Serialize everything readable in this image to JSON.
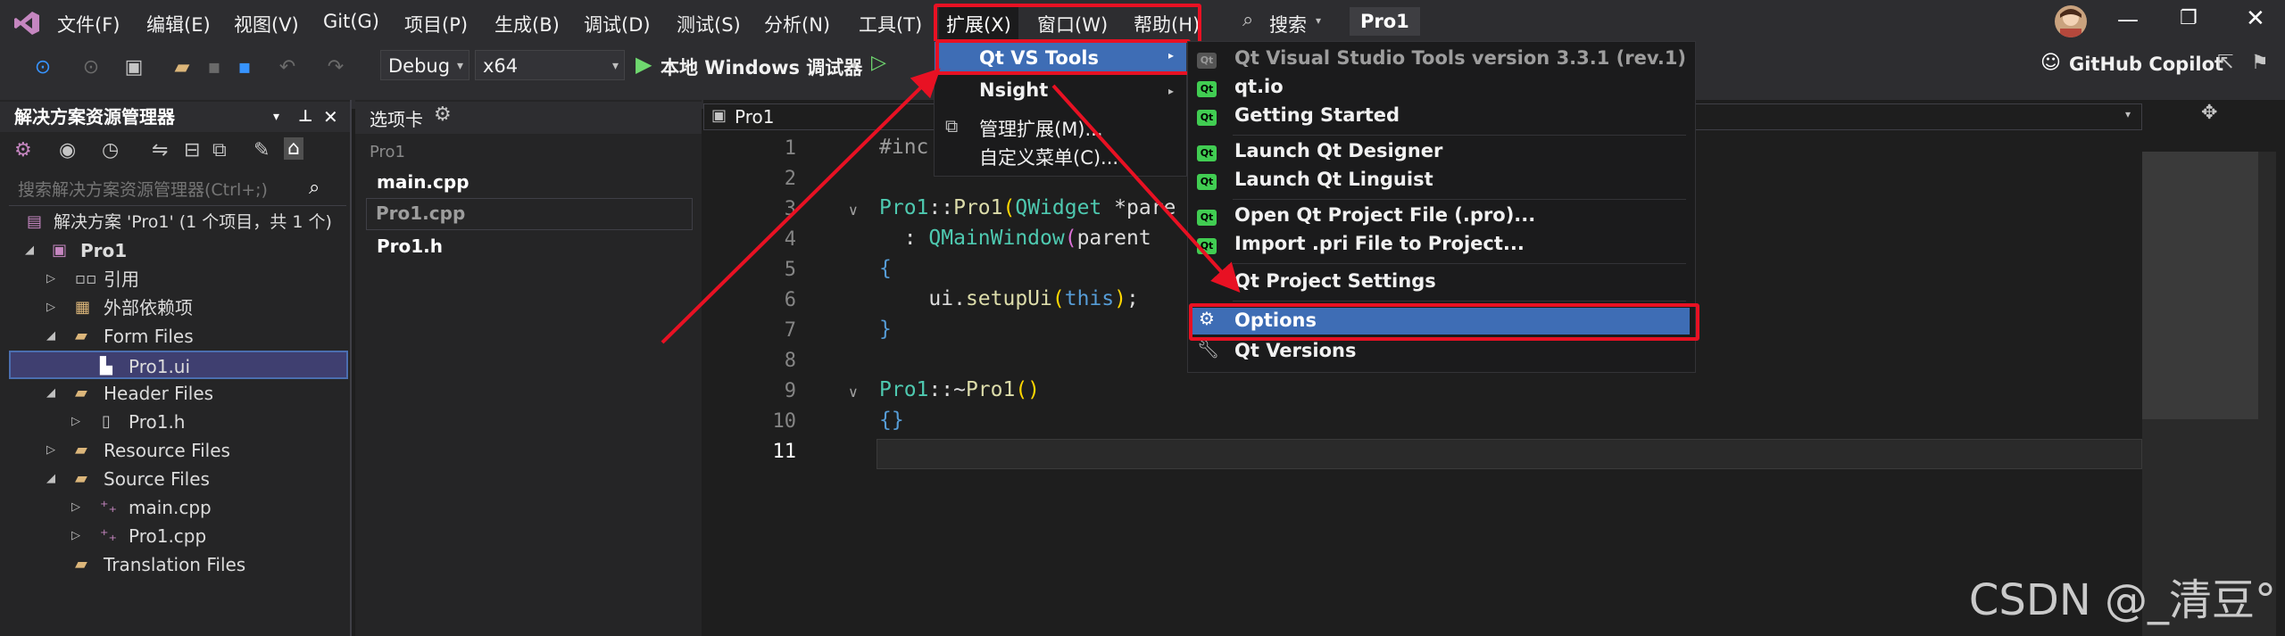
{
  "menubar": {
    "items": [
      "文件(F)",
      "编辑(E)",
      "视图(V)",
      "Git(G)",
      "项目(P)",
      "生成(B)",
      "调试(D)",
      "测试(S)",
      "分析(N)",
      "工具(T)",
      "扩展(X)",
      "窗口(W)",
      "帮助(H)"
    ],
    "search_label": "搜索",
    "project_badge": "Pro1",
    "window_controls": [
      "minimize-icon",
      "restore-icon",
      "close-icon"
    ]
  },
  "toolbar": {
    "config": "Debug",
    "platform": "x64",
    "run_label": "本地 Windows 调试器",
    "copilot_label": "GitHub Copilot"
  },
  "solution_explorer": {
    "title": "解决方案资源管理器",
    "search_placeholder": "搜索解决方案资源管理器(Ctrl+;)",
    "solution_label": "解决方案 'Pro1' (1 个项目，共 1 个)",
    "project": "Pro1",
    "nodes": [
      "引用",
      "外部依赖项",
      "Form Files",
      "Pro1.ui",
      "Header Files",
      "Pro1.h",
      "Resource Files",
      "Source Files",
      "main.cpp",
      "Pro1.cpp",
      "Translation Files"
    ]
  },
  "tabs_panel": {
    "title": "选项卡",
    "group": "Pro1",
    "files": [
      "main.cpp",
      "Pro1.cpp",
      "Pro1.h"
    ]
  },
  "editor": {
    "nav_label": "Pro1",
    "line_numbers": [
      "1",
      "2",
      "3",
      "4",
      "5",
      "6",
      "7",
      "8",
      "9",
      "10",
      "11"
    ]
  },
  "ext_menu": {
    "items": [
      "Qt VS Tools",
      "Nsight",
      "管理扩展(M)...",
      "自定义菜单(C)..."
    ]
  },
  "qt_menu": {
    "items": [
      "Qt Visual Studio Tools version 3.3.1 (rev.1)",
      "qt.io",
      "Getting Started",
      "Launch Qt Designer",
      "Launch Qt Linguist",
      "Open Qt Project File (.pro)...",
      "Import .pri File to Project...",
      "Qt Project Settings",
      "Options",
      "Qt Versions"
    ]
  },
  "watermark": "CSDN @_清豆°"
}
